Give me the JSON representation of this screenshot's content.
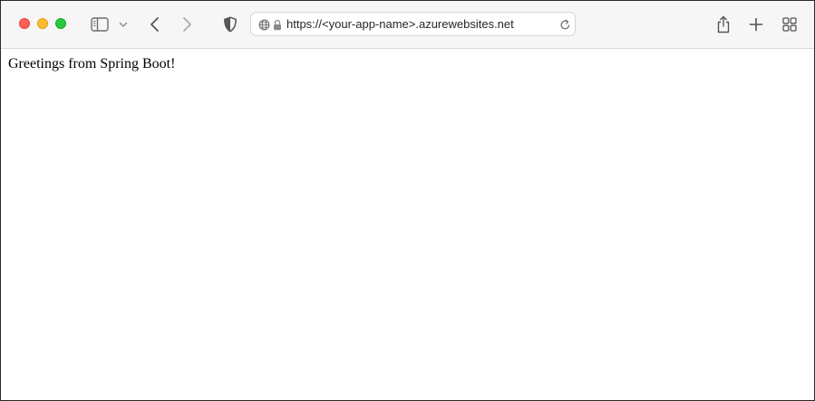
{
  "browser": {
    "address_bar": {
      "url": "https://<your-app-name>.azurewebsites.net"
    },
    "icons": {
      "close": "red-close-icon",
      "minimize": "yellow-minimize-icon",
      "zoom": "green-zoom-icon",
      "sidebar": "sidebar-icon",
      "sidebar_menu": "chevron-down-icon",
      "back": "chevron-left-icon",
      "forward": "chevron-right-icon",
      "privacy": "shield-icon",
      "site": "globe-icon",
      "secure": "lock-icon",
      "reload": "reload-icon",
      "share": "share-icon",
      "new_tab": "plus-icon",
      "tab_overview": "grid-icon"
    },
    "colors": {
      "close": "#ff5f57",
      "minimize": "#febc2e",
      "zoom": "#28c840",
      "toolbar_bg": "#f6f6f6"
    }
  },
  "page": {
    "body_text": "Greetings from Spring Boot!"
  }
}
